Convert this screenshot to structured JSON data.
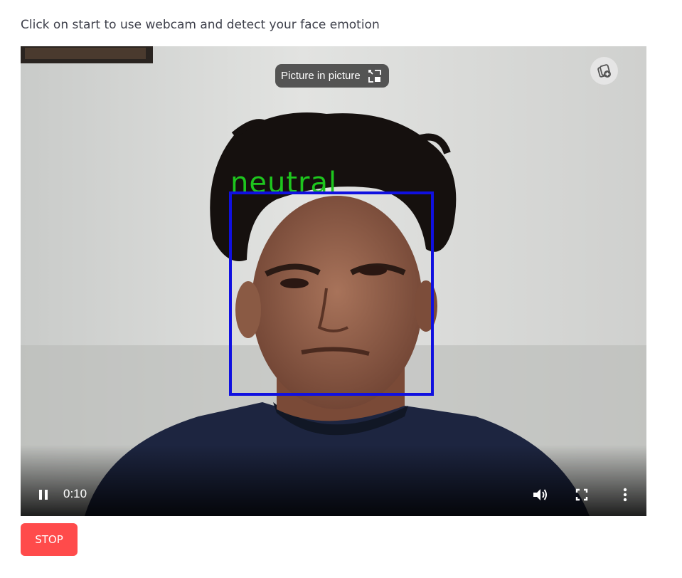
{
  "instruction": "Click on start to use webcam and detect your face emotion",
  "video": {
    "pip_tooltip": "Picture in picture",
    "detection_label": "neutral",
    "detection_label_color": "#1ec61e",
    "box_color": "#1010e0",
    "time": "0:10",
    "icons": [
      "picture-in-picture-icon",
      "pause-icon",
      "volume-icon",
      "fullscreen-icon",
      "more-options-icon"
    ]
  },
  "stop_button": {
    "label": "STOP",
    "color": "#ff4b4b"
  }
}
